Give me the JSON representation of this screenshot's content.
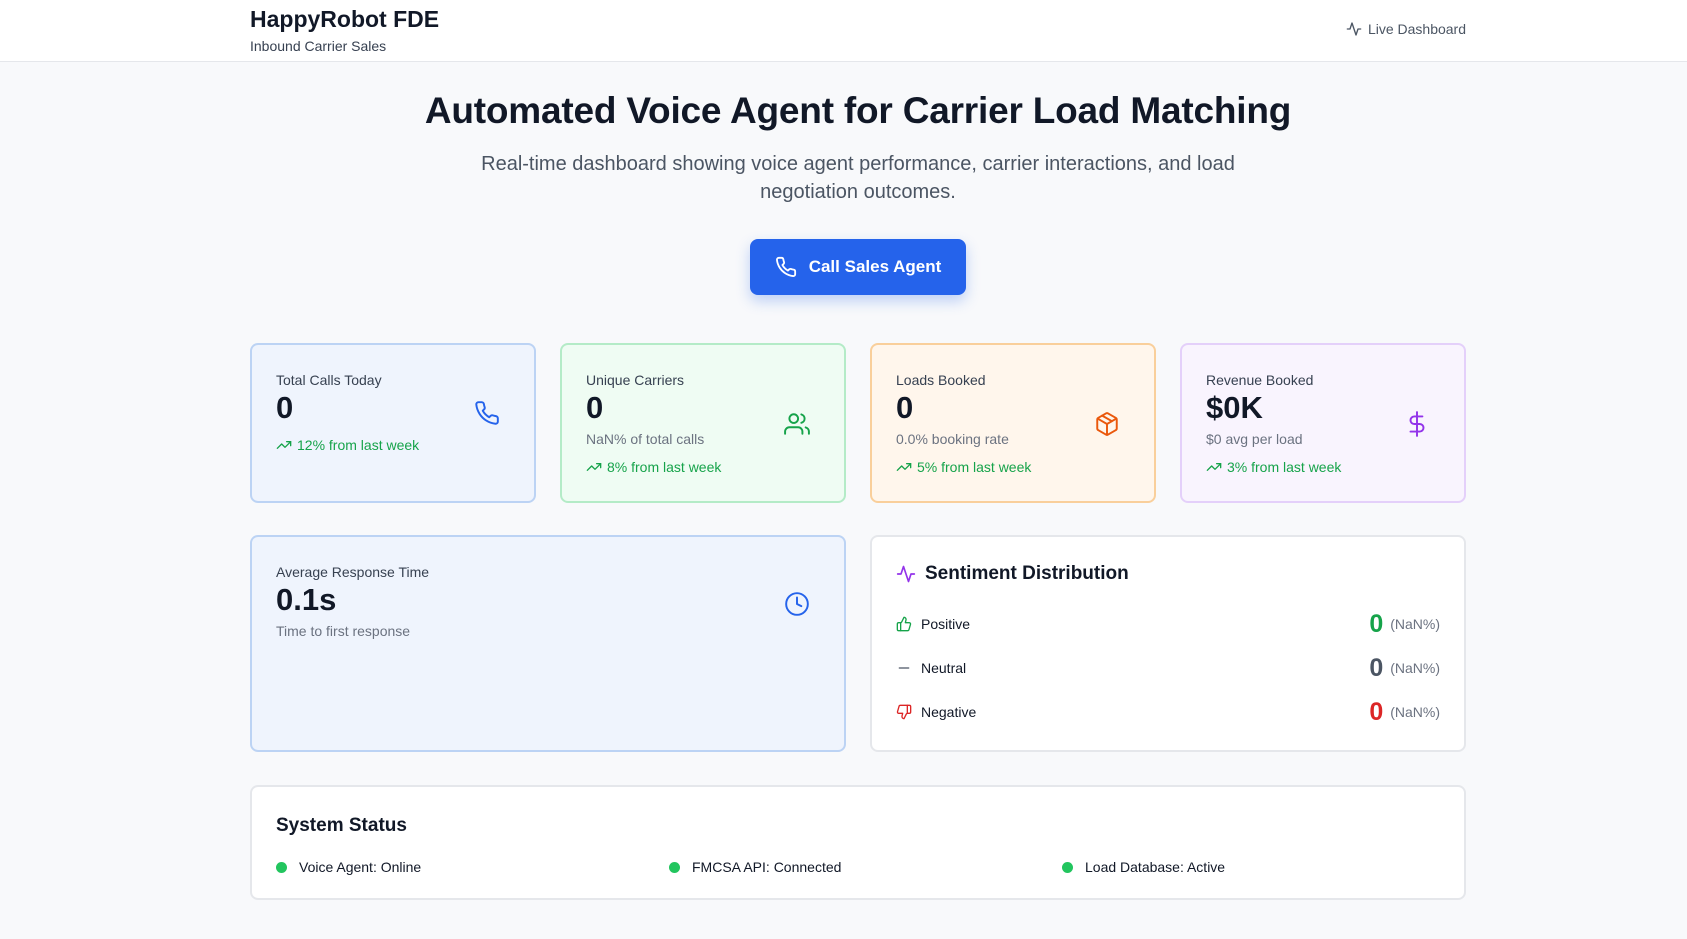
{
  "header": {
    "brand_title": "HappyRobot FDE",
    "brand_subtitle": "Inbound Carrier Sales",
    "live_label": "Live Dashboard",
    "live_icon": "activity-icon"
  },
  "hero": {
    "title": "Automated Voice Agent for Carrier Load Matching",
    "subtitle": "Real-time dashboard showing voice agent performance, carrier interactions, and load negotiation outcomes.",
    "cta_label": "Call Sales Agent",
    "cta_icon": "phone-icon"
  },
  "stats": [
    {
      "label": "Total Calls Today",
      "value": "0",
      "sub": "",
      "trend": "12% from last week",
      "icon": "phone-icon",
      "accent": "#2563eb"
    },
    {
      "label": "Unique Carriers",
      "value": "0",
      "sub": "NaN% of total calls",
      "trend": "8% from last week",
      "icon": "users-icon",
      "accent": "#16a34a"
    },
    {
      "label": "Loads Booked",
      "value": "0",
      "sub": "0.0% booking rate",
      "trend": "5% from last week",
      "icon": "package-icon",
      "accent": "#ea580c"
    },
    {
      "label": "Revenue Booked",
      "value": "$0K",
      "sub": "$0 avg per load",
      "trend": "3% from last week",
      "icon": "dollar-icon",
      "accent": "#9333ea"
    }
  ],
  "response": {
    "label": "Average Response Time",
    "value": "0.1s",
    "sub": "Time to first response",
    "icon": "clock-icon"
  },
  "sentiment": {
    "title": "Sentiment Distribution",
    "items": [
      {
        "label": "Positive",
        "count": "0",
        "pct": "(NaN%)",
        "color": "#16a34a",
        "icon": "thumbs-up-icon"
      },
      {
        "label": "Neutral",
        "count": "0",
        "pct": "(NaN%)",
        "color": "#4b5563",
        "icon": "minus-icon"
      },
      {
        "label": "Negative",
        "count": "0",
        "pct": "(NaN%)",
        "color": "#dc2626",
        "icon": "thumbs-down-icon"
      }
    ]
  },
  "system_status": {
    "title": "System Status",
    "items": [
      {
        "label": "Voice Agent: Online",
        "color": "#22c55e"
      },
      {
        "label": "FMCSA API: Connected",
        "color": "#22c55e"
      },
      {
        "label": "Load Database: Active",
        "color": "#22c55e"
      }
    ]
  },
  "colors": {
    "primary": "#2563eb",
    "trend_up": "#16a34a"
  }
}
